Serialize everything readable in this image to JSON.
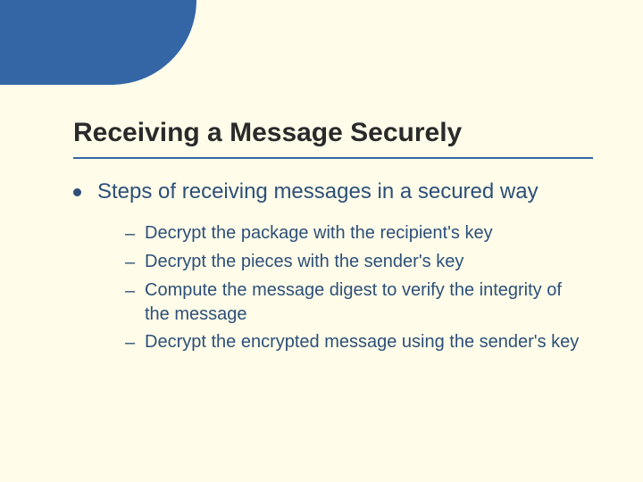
{
  "slide": {
    "title": "Receiving a Message Securely",
    "bullets": [
      {
        "text": "Steps of receiving messages in a secured way",
        "sub": [
          "Decrypt the package with the recipient's key",
          "Decrypt the pieces with the sender's key",
          "Compute the message digest to verify the integrity of the message",
          "Decrypt the encrypted message using the sender's key"
        ]
      }
    ]
  }
}
